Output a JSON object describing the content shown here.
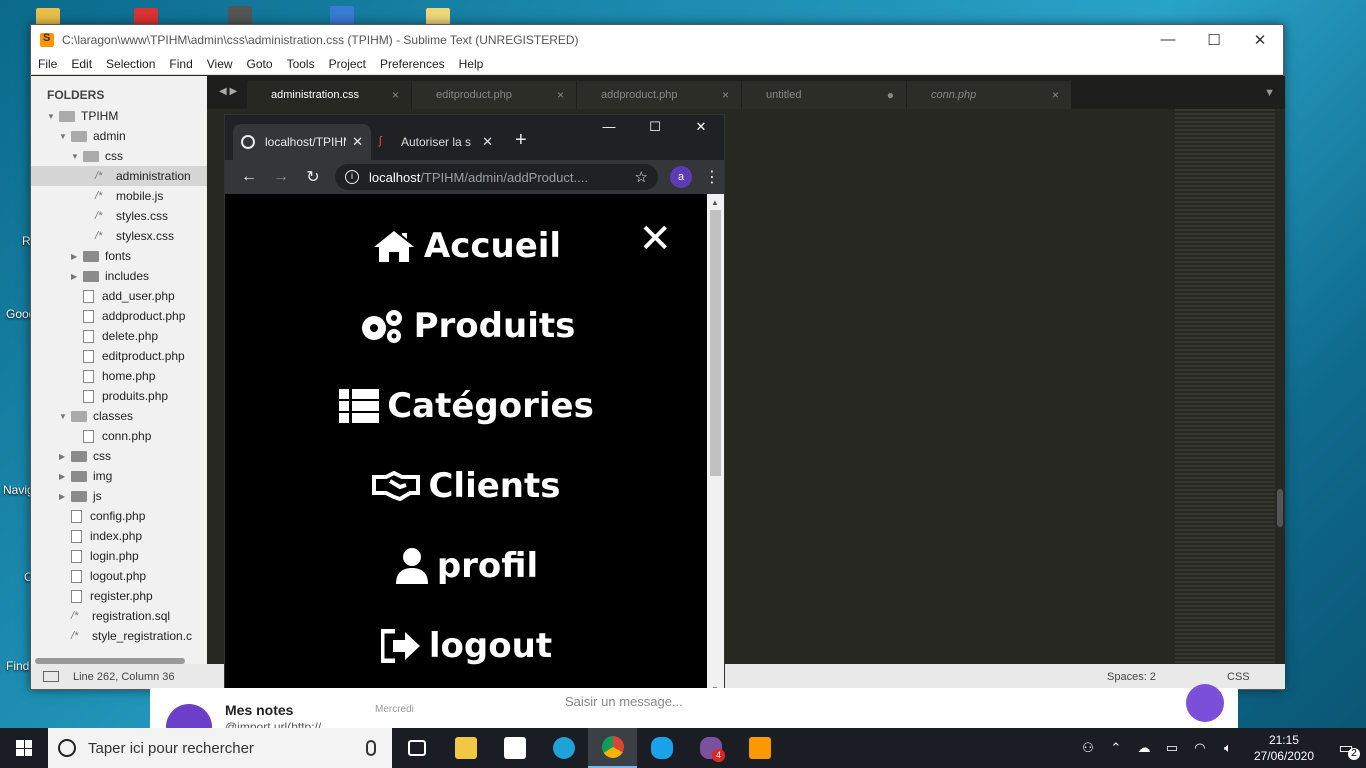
{
  "desktop": {
    "labels": [
      "R",
      "Good",
      "Navig",
      "C",
      "Find"
    ]
  },
  "sublime": {
    "title": "C:\\laragon\\www\\TPIHM\\admin\\css\\administration.css (TPIHM) - Sublime Text (UNREGISTERED)",
    "menu": [
      "File",
      "Edit",
      "Selection",
      "Find",
      "View",
      "Goto",
      "Tools",
      "Project",
      "Preferences",
      "Help"
    ],
    "sidebar": {
      "heading": "FOLDERS",
      "rows": [
        {
          "label": "TPIHM",
          "kind": "folder-open",
          "indent": 0
        },
        {
          "label": "admin",
          "kind": "folder-open",
          "indent": 1
        },
        {
          "label": "css",
          "kind": "folder-open",
          "indent": 2
        },
        {
          "label": "administration",
          "kind": "comment-file",
          "indent": 3,
          "selected": true
        },
        {
          "label": "mobile.js",
          "kind": "comment-file",
          "indent": 3
        },
        {
          "label": "styles.css",
          "kind": "comment-file",
          "indent": 3
        },
        {
          "label": "stylesx.css",
          "kind": "comment-file",
          "indent": 3
        },
        {
          "label": "fonts",
          "kind": "folder",
          "indent": 2
        },
        {
          "label": "includes",
          "kind": "folder",
          "indent": 2
        },
        {
          "label": "add_user.php",
          "kind": "file",
          "indent": 2
        },
        {
          "label": "addproduct.php",
          "kind": "file",
          "indent": 2
        },
        {
          "label": "delete.php",
          "kind": "file",
          "indent": 2
        },
        {
          "label": "editproduct.php",
          "kind": "file",
          "indent": 2
        },
        {
          "label": "home.php",
          "kind": "file",
          "indent": 2
        },
        {
          "label": "produits.php",
          "kind": "file",
          "indent": 2
        },
        {
          "label": "classes",
          "kind": "folder-open",
          "indent": 1
        },
        {
          "label": "conn.php",
          "kind": "file",
          "indent": 2
        },
        {
          "label": "css",
          "kind": "folder",
          "indent": 1
        },
        {
          "label": "img",
          "kind": "folder",
          "indent": 1
        },
        {
          "label": "js",
          "kind": "folder",
          "indent": 1
        },
        {
          "label": "config.php",
          "kind": "file",
          "indent": 1
        },
        {
          "label": "index.php",
          "kind": "file",
          "indent": 1
        },
        {
          "label": "login.php",
          "kind": "file",
          "indent": 1
        },
        {
          "label": "logout.php",
          "kind": "file",
          "indent": 1
        },
        {
          "label": "register.php",
          "kind": "file",
          "indent": 1
        },
        {
          "label": "registration.sql",
          "kind": "comment-file",
          "indent": 1
        },
        {
          "label": "style_registration.c",
          "kind": "comment-file",
          "indent": 1
        }
      ]
    },
    "tabs": [
      {
        "label": "administration.css",
        "close": "×",
        "active": true
      },
      {
        "label": "editproduct.php",
        "close": "×"
      },
      {
        "label": "addproduct.php",
        "close": "×"
      },
      {
        "label": "untitled",
        "close": "●"
      },
      {
        "label": "conn.php",
        "close": "×"
      }
    ],
    "status": {
      "position": "Line 262, Column 36",
      "spaces": "Spaces: 2",
      "syntax": "CSS"
    }
  },
  "chrome": {
    "tabs": [
      {
        "label": "localhost/TPIHM",
        "active": true
      },
      {
        "label": "Autoriser la s"
      }
    ],
    "url_host": "localhost",
    "url_path": "/TPIHM/admin/addProduct....",
    "avatar_letter": "a",
    "menu_items": [
      {
        "label": "Accueil",
        "icon": "home-icon"
      },
      {
        "label": "Produits",
        "icon": "cogs-icon"
      },
      {
        "label": "Catégories",
        "icon": "list-icon"
      },
      {
        "label": "Clients",
        "icon": "handshake-icon"
      },
      {
        "label": "profil",
        "icon": "user-icon"
      },
      {
        "label": "logout",
        "icon": "sign-out-icon"
      }
    ],
    "close_symbol": "✕"
  },
  "notes": {
    "title": "Mes notes",
    "subtitle": "@import url(http://",
    "day": "Mercredi",
    "message_placeholder": "Saisir un message..."
  },
  "taskbar": {
    "search_placeholder": "Taper ici pour rechercher",
    "time": "21:15",
    "date": "27/06/2020",
    "notification_count": "2",
    "viber_badge": "4"
  }
}
